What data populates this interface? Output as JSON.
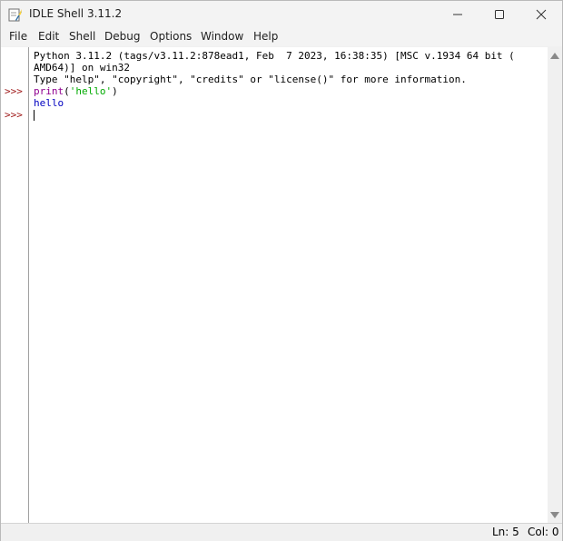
{
  "window": {
    "title": "IDLE Shell 3.11.2",
    "icon": "idle-feather-icon"
  },
  "menubar": {
    "items": [
      "File",
      "Edit",
      "Shell",
      "Debug",
      "Options",
      "Window",
      "Help"
    ]
  },
  "shell": {
    "prompt": ">>>",
    "banner_line1": "Python 3.11.2 (tags/v3.11.2:878ead1, Feb  7 2023, 16:38:35) [MSC v.1934 64 bit (",
    "banner_line2": "AMD64)] on win32",
    "banner_line3": "Type \"help\", \"copyright\", \"credits\" or \"license()\" for more information.",
    "input_func": "print",
    "input_open": "(",
    "input_string": "'hello'",
    "input_close": ")",
    "output": "hello"
  },
  "statusbar": {
    "ln": "Ln: 5",
    "col": "Col: 0"
  },
  "colors": {
    "prompt": "#a01a1a",
    "builtin": "#900090",
    "string": "#00aa00",
    "stdout": "#0000c0"
  }
}
